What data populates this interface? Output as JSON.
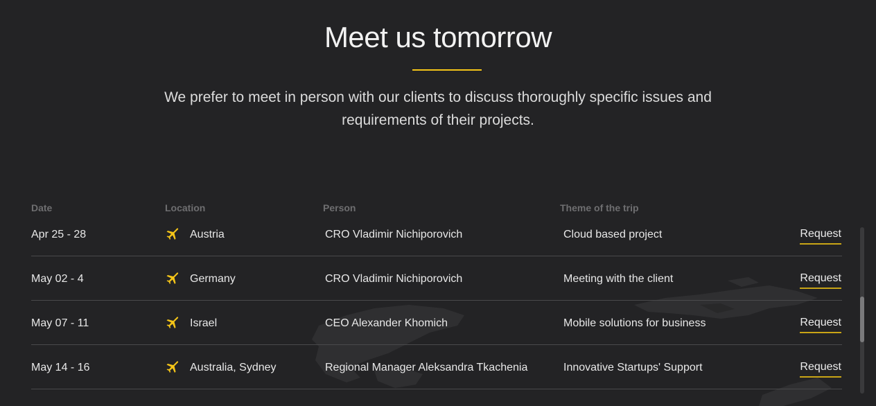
{
  "header": {
    "title": "Meet us tomorrow",
    "subtitle_line1": "We prefer to meet in person with our clients to discuss thoroughly specific issues and",
    "subtitle_line2": "requirements of their projects."
  },
  "colors": {
    "background": "#232325",
    "accent": "#f5c518",
    "divider": "#4a4a4c",
    "header_text": "#6e6e70"
  },
  "table": {
    "columns": {
      "date": "Date",
      "location": "Location",
      "person": "Person",
      "theme": "Theme of the trip"
    },
    "rows": [
      {
        "date": "Apr 25 - 28",
        "icon": "airplane-icon",
        "location": "Austria",
        "person": "CRO Vladimir Nichiporovich",
        "theme": "Cloud based project",
        "action": "Request"
      },
      {
        "date": "May 02 - 4",
        "icon": "airplane-icon",
        "location": "Germany",
        "person": "CRO Vladimir Nichiporovich",
        "theme": "Meeting with the client",
        "action": "Request"
      },
      {
        "date": "May 07 - 11",
        "icon": "airplane-icon",
        "location": "Israel",
        "person": "CEO Alexander Khomich",
        "theme": "Mobile solutions for business",
        "action": "Request"
      },
      {
        "date": "May 14 - 16",
        "icon": "airplane-icon",
        "location": "Australia, Sydney",
        "person": "Regional Manager Aleksandra Tkachenia",
        "theme": "Innovative Startups' Support",
        "action": "Request"
      }
    ]
  }
}
